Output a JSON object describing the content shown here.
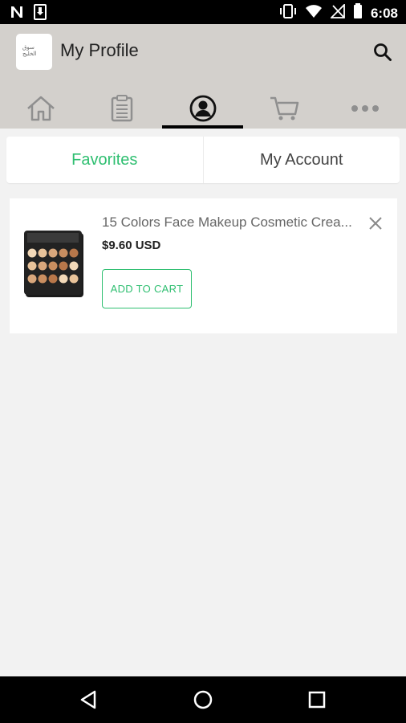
{
  "status_bar": {
    "time": "6:08",
    "icons": [
      "n-icon",
      "download-icon",
      "vibrate-icon",
      "wifi-icon",
      "no-signal-icon",
      "battery-icon"
    ]
  },
  "header": {
    "logo_text": "سوق الخليج",
    "title": "My Profile",
    "search_icon": "search-icon"
  },
  "tabs": [
    {
      "name": "home",
      "icon": "home-icon",
      "active": false
    },
    {
      "name": "orders",
      "icon": "clipboard-icon",
      "active": false
    },
    {
      "name": "profile",
      "icon": "user-icon",
      "active": true
    },
    {
      "name": "cart",
      "icon": "cart-icon",
      "active": false
    },
    {
      "name": "more",
      "icon": "more-icon",
      "active": false
    }
  ],
  "segments": {
    "favorites": "Favorites",
    "my_account": "My Account",
    "active": "favorites"
  },
  "favorites": [
    {
      "title": "15 Colors Face Makeup Cosmetic Crea...",
      "price": "$9.60 USD",
      "button": "ADD TO CART",
      "image": "makeup-palette"
    }
  ],
  "colors": {
    "accent": "#2fbf71",
    "header_bg": "#d3d0cc",
    "page_bg": "#f2f2f2"
  }
}
